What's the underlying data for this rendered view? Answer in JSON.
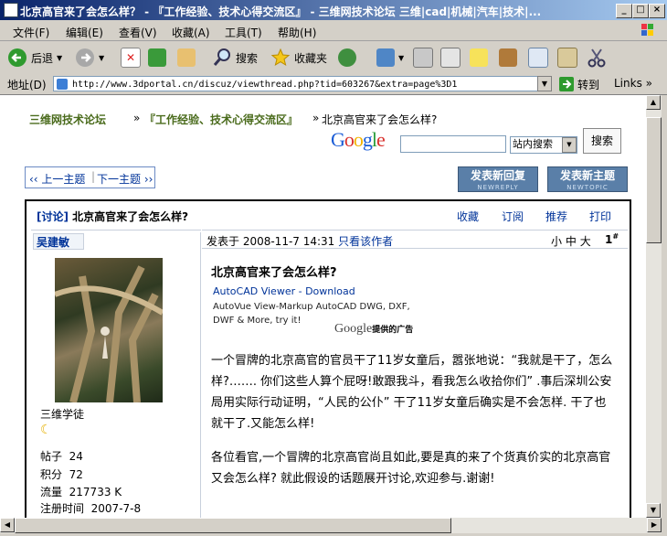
{
  "window": {
    "title": "北京高官来了会怎么样？ - 『工作经验、技术心得交流区』 - 三维网技术论坛 三维|cad|机械|汽车|技术|..."
  },
  "menu": [
    "文件(F)",
    "编辑(E)",
    "查看(V)",
    "收藏(A)",
    "工具(T)",
    "帮助(H)"
  ],
  "toolbar": {
    "back": "后退",
    "search": "搜索",
    "favorites": "收藏夹"
  },
  "address": {
    "label": "地址(D)",
    "url": "http://www.3dportal.cn/discuz/viewthread.php?tid=603267&extra=page%3D1",
    "go": "转到",
    "links": "Links"
  },
  "breadcrumb": {
    "home": "三维网技术论坛",
    "sep1": "»",
    "forum": "『工作经验、技术心得交流区』",
    "sep2": "»",
    "thread": "北京高官来了会怎么样?"
  },
  "google": {
    "logo": "Google",
    "select": "站内搜索",
    "button": "搜索"
  },
  "nav": {
    "prev": "‹‹ 上一主题",
    "next": "下一主题 ››"
  },
  "buttons": {
    "reply": "发表新回复",
    "reply_en": "NEWREPLY",
    "newtopic": "发表新主题",
    "newtopic_en": "NEWTOPIC"
  },
  "thread": {
    "tag": "[讨论]",
    "title": "北京高官来了会怎么样?",
    "actions": [
      "收藏",
      "订阅",
      "推荐",
      "打印"
    ]
  },
  "post": {
    "author": "吴建敏",
    "posted": "发表于 2008-11-7 14:31",
    "only_author": "只看该作者",
    "font_sizes": [
      "小",
      "中",
      "大"
    ],
    "floor": "1",
    "floor_sup": "#",
    "subject": "北京高官来了会怎么样?",
    "ad_title": "AutoCAD Viewer - Download",
    "ad_body": "AutoVue View-Markup AutoCAD DWG, DXF, DWF & More, try it!",
    "ad_google": "Google",
    "ad_note": "提供的广告",
    "para1": "一个冒牌的北京高官的官员干了11岁女童后，嚣张地说：“我就是干了，怎么样?……. 你们这些人算个屁呀!敢跟我斗，看我怎么收拾你们” .事后深圳公安局用实际行动证明，“人民的公仆” 干了11岁女童后确实是不会怎样. 干了也就干了.又能怎么样!",
    "para2": "各位看官,一个冒牌的北京高官尚且如此,要是真的来了个货真价实的北京高官又会怎么样? 就此假设的话题展开讨论,欢迎参与.谢谢!"
  },
  "user": {
    "rank": "三维学徒",
    "stats": [
      {
        "label": "帖子",
        "value": "24"
      },
      {
        "label": "积分",
        "value": "72"
      },
      {
        "label": "流量",
        "value": "217733 K"
      },
      {
        "label": "注册时间",
        "value": "2007-7-8"
      }
    ]
  }
}
